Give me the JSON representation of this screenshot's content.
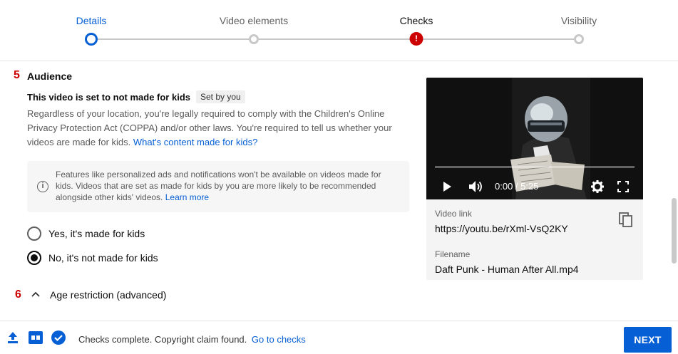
{
  "stepper": {
    "steps": [
      {
        "label": "Details",
        "state": "active"
      },
      {
        "label": "Video elements",
        "state": "idle"
      },
      {
        "label": "Checks",
        "state": "error",
        "badge": "!"
      },
      {
        "label": "Visibility",
        "state": "idle"
      }
    ]
  },
  "audience": {
    "number": "5",
    "title": "Audience",
    "status": "This video is set to not made for kids",
    "status_chip": "Set by you",
    "description": "Regardless of your location, you're legally required to comply with the Children's Online Privacy Protection Act (COPPA) and/or other laws. You're required to tell us whether your videos are made for kids.",
    "description_link": "What's content made for kids?",
    "info_text": "Features like personalized ads and notifications won't be available on videos made for kids. Videos that are set as made for kids by you are more likely to be recommended alongside other kids' videos.",
    "info_link": "Learn more",
    "options": [
      {
        "label": "Yes, it's made for kids",
        "checked": false
      },
      {
        "label": "No, it's not made for kids",
        "checked": true
      }
    ]
  },
  "age_restriction": {
    "number": "6",
    "title": "Age restriction (advanced)"
  },
  "video_panel": {
    "time": "0:00 / 5:25",
    "link_label": "Video link",
    "link": "https://youtu.be/rXml-VsQ2KY",
    "filename_label": "Filename",
    "filename": "Daft Punk - Human After All.mp4"
  },
  "footer": {
    "status": "Checks complete. Copyright claim found.",
    "link": "Go to checks",
    "next_label": "NEXT"
  },
  "colors": {
    "accent": "#065fd4",
    "error": "#cc0000"
  }
}
